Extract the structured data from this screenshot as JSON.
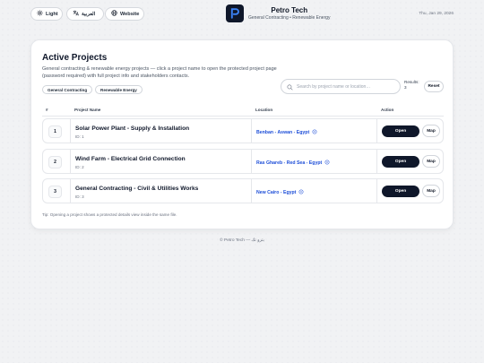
{
  "topbar": {
    "theme_label": "Light",
    "language_label": "العربية",
    "website_label": "Website",
    "brand_title": "Petro Tech",
    "brand_subtitle": "General Contracting • Renewable Energy",
    "date": "Thu, Jan 29, 2026"
  },
  "card": {
    "title": "Active Projects",
    "description": "General contracting & renewable energy projects — click a project name to open the protected project page (password required) with full project info and stakeholders contacts.",
    "tags": [
      "General Contracting",
      "Renewable Energy"
    ],
    "search_placeholder": "Search by project name or location…",
    "search_value": "",
    "results_label": "Results:",
    "results_count": "3",
    "reset_label": "Reset"
  },
  "table": {
    "headers": {
      "num": "#",
      "name": "Project Name",
      "location": "Location",
      "action": "Action"
    },
    "rows": [
      {
        "num": "1",
        "name": "Solar Power Plant - Supply & Installation",
        "id": "ID: 1",
        "location": "Benban - Aswan - Egypt",
        "open": "Open",
        "map": "Map"
      },
      {
        "num": "2",
        "name": "Wind Farm - Electrical Grid Connection",
        "id": "ID: 2",
        "location": "Ras Ghareb - Red Sea - Egypt",
        "open": "Open",
        "map": "Map"
      },
      {
        "num": "3",
        "name": "General Contracting - Civil & Utilities Works",
        "id": "ID: 3",
        "location": "New Cairo - Egypt",
        "open": "Open",
        "map": "Map"
      }
    ]
  },
  "tip": "Tip: Opening a project shows a protected details view inside the same file.",
  "footer": "© Petro Tech — بترو تك",
  "colors": {
    "accent": "#0f172a",
    "link": "#1d4ed8",
    "brand_logo": "#0f172a"
  },
  "icons": [
    "sun-icon",
    "translate-icon",
    "globe-icon",
    "search-icon",
    "map-pin-icon"
  ]
}
